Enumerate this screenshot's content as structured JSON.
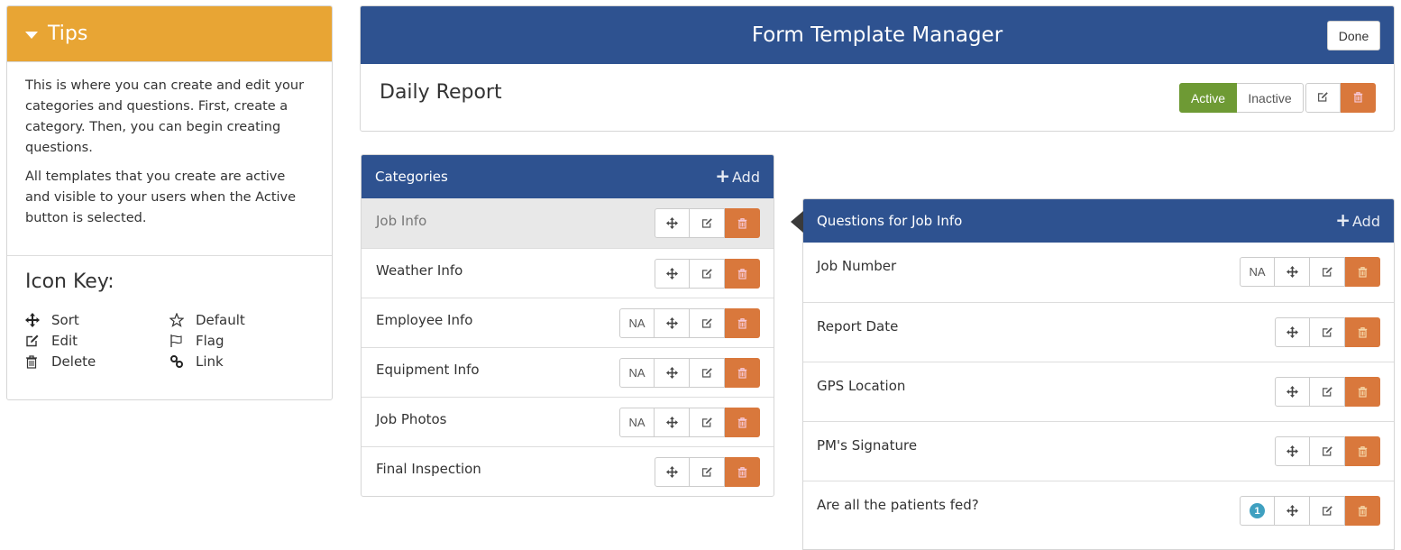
{
  "tips": {
    "title": "Tips",
    "paragraphs": [
      "This is where you can create and edit your categories and questions. First, create a category. Then, you can begin creating questions.",
      "All templates that you create are active and visible to your users when the Active button is selected."
    ],
    "icon_key": {
      "title": "Icon Key:",
      "items": [
        {
          "icon": "sort-icon",
          "label": "Sort"
        },
        {
          "icon": "star-icon",
          "label": "Default"
        },
        {
          "icon": "edit-icon",
          "label": "Edit"
        },
        {
          "icon": "flag-icon",
          "label": "Flag"
        },
        {
          "icon": "trash-icon",
          "label": "Delete"
        },
        {
          "icon": "link-icon",
          "label": "Link"
        }
      ]
    }
  },
  "header": {
    "title": "Form Template Manager",
    "done_label": "Done"
  },
  "template": {
    "name": "Daily Report",
    "status_active_label": "Active",
    "status_inactive_label": "Inactive",
    "status": "Active"
  },
  "categories": {
    "title": "Categories",
    "add_label": "Add",
    "items": [
      {
        "label": "Job Info",
        "selected": true,
        "na": false
      },
      {
        "label": "Weather Info",
        "selected": false,
        "na": false
      },
      {
        "label": "Employee Info",
        "selected": false,
        "na": true,
        "na_label": "NA"
      },
      {
        "label": "Equipment Info",
        "selected": false,
        "na": true,
        "na_label": "NA"
      },
      {
        "label": "Job Photos",
        "selected": false,
        "na": true,
        "na_label": "NA"
      },
      {
        "label": "Final Inspection",
        "selected": false,
        "na": false
      }
    ]
  },
  "questions": {
    "title": "Questions for Job Info",
    "add_label": "Add",
    "items": [
      {
        "label": "Job Number",
        "na_label": "NA"
      },
      {
        "label": "Report Date"
      },
      {
        "label": "GPS Location"
      },
      {
        "label": "PM's Signature"
      },
      {
        "label": "Are all the patients fed?",
        "badge": "1"
      }
    ]
  },
  "colors": {
    "primary": "#2e5290",
    "tips_header": "#e8a534",
    "active": "#6e9a34",
    "delete": "#d9783c",
    "badge": "#3fa0c0"
  }
}
